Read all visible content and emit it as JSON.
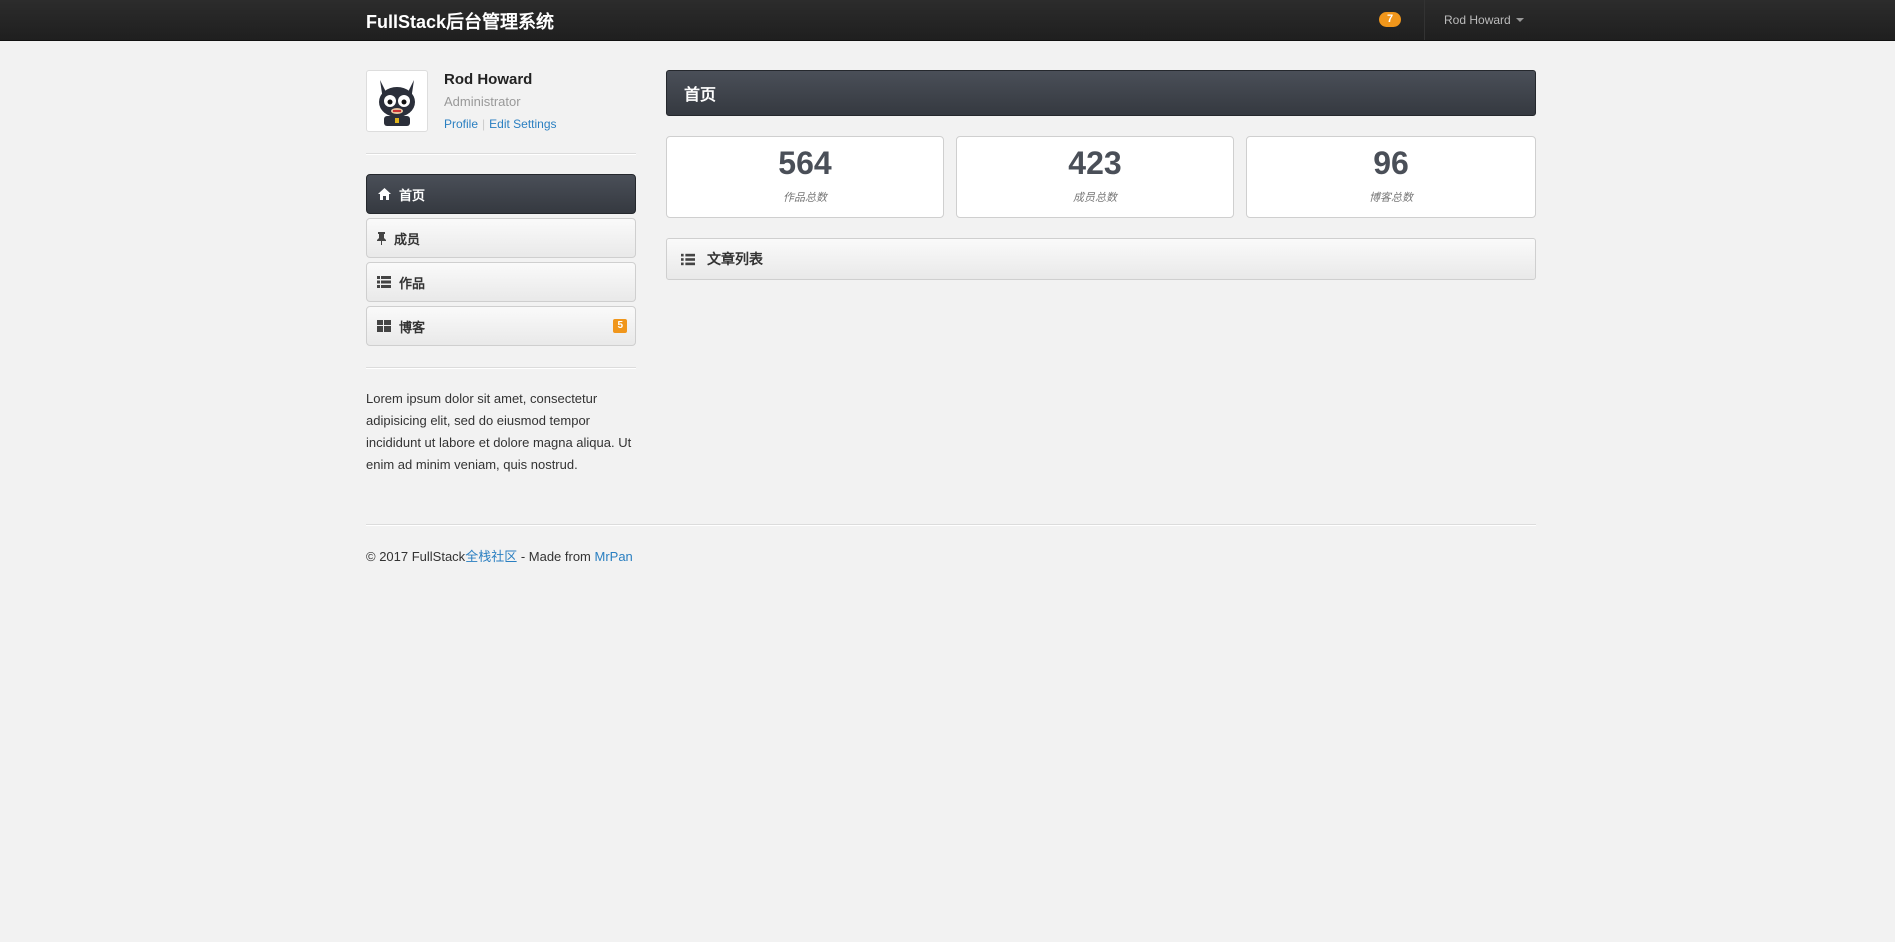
{
  "navbar": {
    "brand": "FullStack后台管理系统",
    "notification_count": "7",
    "user_name": "Rod Howard"
  },
  "profile": {
    "name": "Rod Howard",
    "role": "Administrator",
    "profile_link": "Profile",
    "settings_link": "Edit Settings"
  },
  "sidebar": {
    "items": [
      {
        "label": "首页",
        "icon": "home-icon",
        "active": true
      },
      {
        "label": "成员",
        "icon": "pin-icon"
      },
      {
        "label": "作品",
        "icon": "list-icon"
      },
      {
        "label": "博客",
        "icon": "grid-icon",
        "badge": "5"
      }
    ],
    "description": "Lorem ipsum dolor sit amet, consectetur adipisicing elit, sed do eiusmod tempor incididunt ut labore et dolore magna aliqua. Ut enim ad minim veniam, quis nostrud."
  },
  "main": {
    "title": "首页",
    "stats": [
      {
        "value": "564",
        "label": "作品总数"
      },
      {
        "value": "423",
        "label": "成员总数"
      },
      {
        "value": "96",
        "label": "博客总数"
      }
    ],
    "article_list_title": "文章列表"
  },
  "footer": {
    "prefix": "© 2017 FullStack",
    "community_link": "全栈社区",
    "middle": " - Made from ",
    "author_link": "MrPan"
  },
  "colors": {
    "accent_badge": "#f0961b",
    "link": "#2a7fc1",
    "header_dark": "#3d4149"
  }
}
